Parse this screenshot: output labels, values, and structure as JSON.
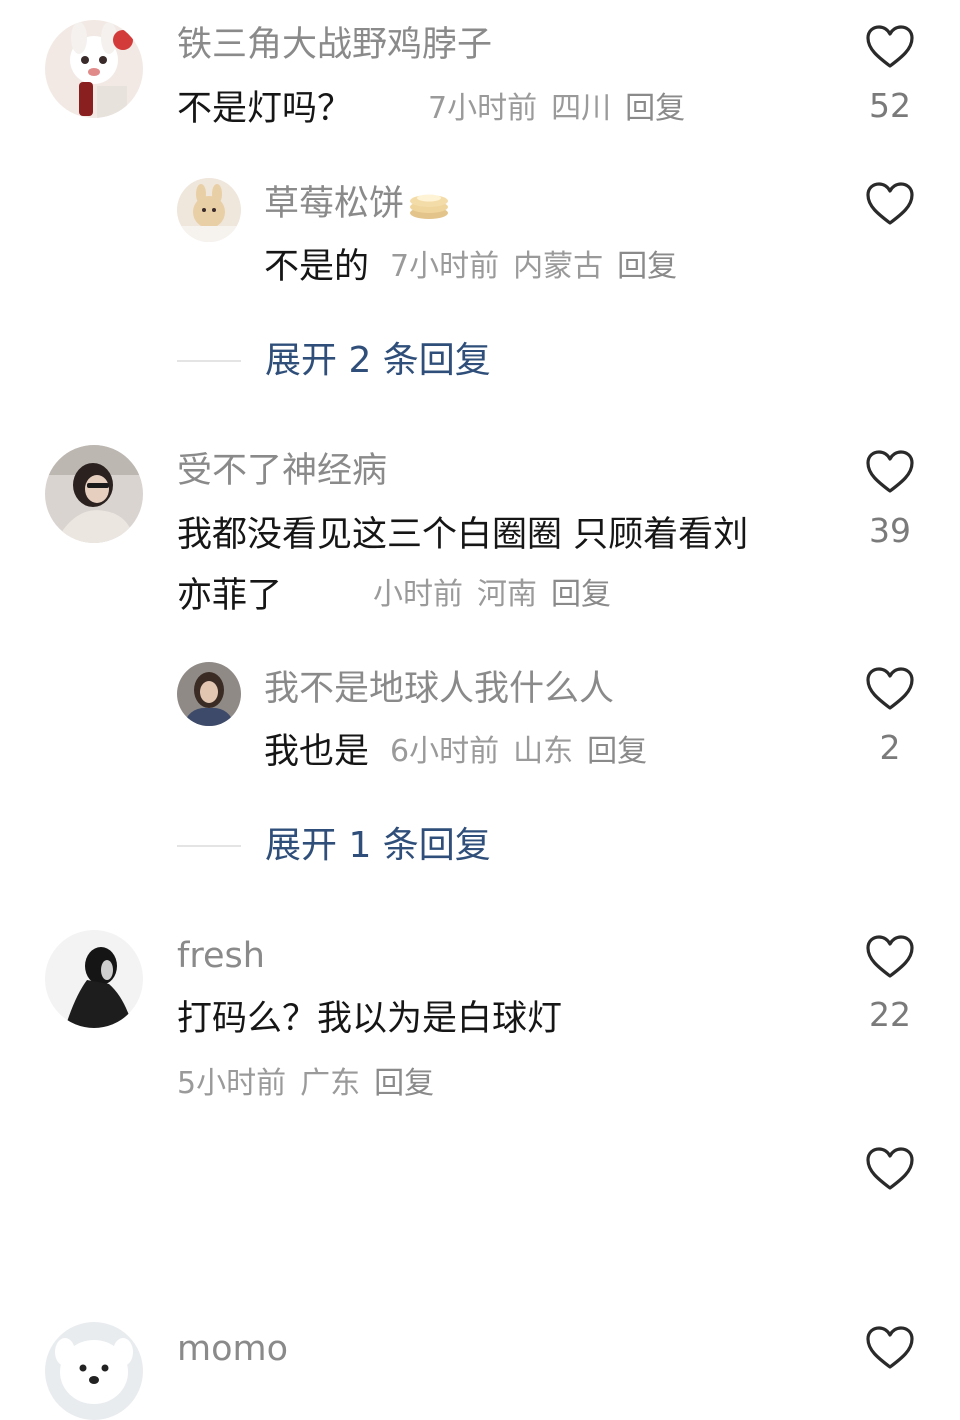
{
  "comments": [
    {
      "username": "铁三角大战野鸡脖子",
      "text": "不是灯吗？",
      "time": "7小时前",
      "location": "四川",
      "reply": "回复",
      "likes": "52",
      "replies": [
        {
          "username": "草莓松饼",
          "text": "不是的",
          "time": "7小时前",
          "location": "内蒙古",
          "reply": "回复",
          "likes": ""
        }
      ],
      "expand_label": "展开 2 条回复"
    },
    {
      "username": "受不了神经病",
      "text_line1": "我都没看见这三个白圈圈 只顾着看刘",
      "text_line2": "亦菲了",
      "time": "小时前",
      "location": "河南",
      "reply": "回复",
      "likes": "39",
      "replies": [
        {
          "username": "我不是地球人我什么人",
          "text": "我也是",
          "time": "6小时前",
          "location": "山东",
          "reply": "回复",
          "likes": "2"
        }
      ],
      "expand_label": "展开 1 条回复"
    },
    {
      "username": "fresh",
      "text": "打码么？我以为是白球灯",
      "time": "5小时前",
      "location": "广东",
      "reply": "回复",
      "likes": "22"
    },
    {
      "username": "momo"
    }
  ],
  "icons": {
    "like": "heart-outline-icon",
    "emoji": "pancake-emoji-icon"
  },
  "colors": {
    "username": "#8a8a8a",
    "text": "#161616",
    "meta": "#9a9a9a",
    "expand": "#2f4f7a"
  }
}
